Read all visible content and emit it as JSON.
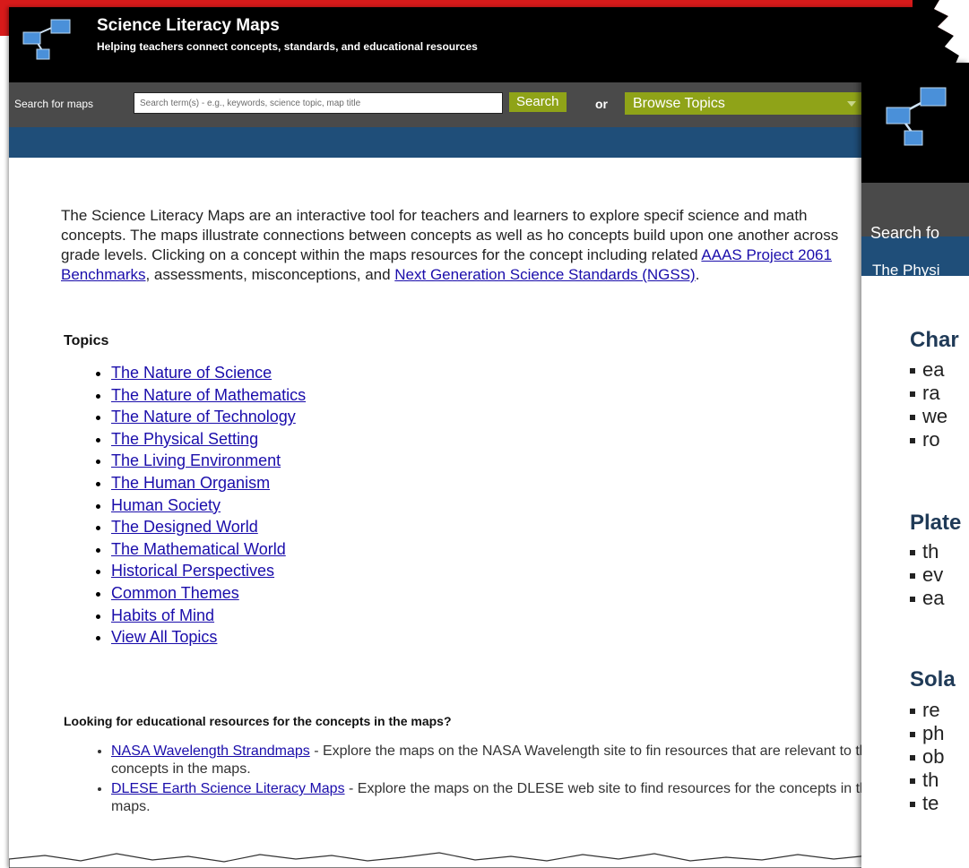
{
  "header": {
    "title": "Science Literacy Maps",
    "tagline": "Helping teachers connect concepts, standards, and educational resources"
  },
  "search": {
    "label": "Search for maps",
    "placeholder": "Search term(s) - e.g., keywords, science topic, map title",
    "button_label": "Search",
    "or_label": "or",
    "browse_label": "Browse Topics"
  },
  "intro": {
    "text_before_link1": "The Science Literacy Maps are an interactive tool for teachers and learners to explore specif science and math concepts. The maps illustrate connections between concepts as well as ho concepts build upon one another across grade levels. Clicking on a concept within the maps resources for the concept including related ",
    "link1": "AAAS Project 2061 Benchmarks",
    "text_between": ", assessments, misconceptions, and ",
    "link2": "Next Generation Science Standards (NGSS)",
    "text_after": "."
  },
  "topics": {
    "heading": "Topics",
    "items": [
      "The Nature of Science",
      "The Nature of Mathematics",
      "The Nature of Technology",
      "The Physical Setting",
      "The Living Environment",
      "The Human Organism",
      "Human Society",
      "The Designed World",
      "The Mathematical World",
      "Historical Perspectives",
      "Common Themes",
      "Habits of Mind",
      "View All Topics"
    ]
  },
  "resources": {
    "heading": "Looking for educational resources for the concepts in the maps?",
    "items": [
      {
        "link": "NASA Wavelength Strandmaps",
        "text": " - Explore the maps on the NASA Wavelength site to fin resources that are relevant to the concepts in the maps."
      },
      {
        "link": "DLESE Earth Science Literacy Maps",
        "text": " - Explore the maps on the DLESE web site to find resources for the concepts in the maps."
      }
    ]
  },
  "overlay": {
    "search_label": "Search fo",
    "breadcrumb": "The Physi",
    "sections": [
      {
        "heading": "Char",
        "items": [
          "ea",
          "ra",
          "we",
          "ro"
        ]
      },
      {
        "heading": "Plate",
        "items": [
          "th",
          "ev",
          "ea"
        ]
      },
      {
        "heading": "Sola",
        "items": [
          "re",
          "ph",
          "ob",
          "th",
          "te"
        ]
      }
    ]
  },
  "colors": {
    "header_bg": "#000000",
    "search_bar_bg": "#4a4a4a",
    "accent_green": "#8fa318",
    "nav_blue": "#1f4e79",
    "link": "#1a0dab",
    "frame_red": "#d71a1a"
  },
  "icons": [
    "concept-map-logo-icon",
    "dropdown-caret-icon"
  ]
}
